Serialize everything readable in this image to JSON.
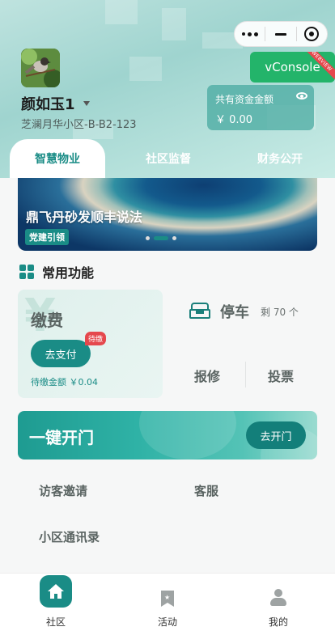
{
  "capsule": {
    "more_icon": "more-dots-icon",
    "minimize_icon": "minimize-icon",
    "close_icon": "target-close-icon"
  },
  "user": {
    "name": "颜如玉1",
    "address": "芝澜月华小区-B-B2-123"
  },
  "vconsole": {
    "label": "vConsole",
    "ribbon": "WEBVIEW"
  },
  "fund": {
    "label": "共有资金金额",
    "amount": "￥ 0.00"
  },
  "tabs": [
    {
      "label": "智慧物业",
      "active": true
    },
    {
      "label": "社区监督"
    },
    {
      "label": "财务公开"
    }
  ],
  "banner": {
    "title": "鼎飞丹砂发顺丰说法",
    "tag": "党建引领"
  },
  "functions": {
    "title": "常用功能",
    "pay": {
      "title": "缴费",
      "button": "去支付",
      "badge": "待缴",
      "amount": "待缴金额 ￥0.04"
    },
    "parking": {
      "label": "停车",
      "remain": "剩 70 个"
    },
    "repair": "报修",
    "vote": "投票"
  },
  "door": {
    "title": "一键开门",
    "button": "去开门"
  },
  "links": {
    "visitor": "访客邀请",
    "service": "客服",
    "directory": "小区通讯录"
  },
  "tabbar": [
    {
      "label": "社区",
      "active": true
    },
    {
      "label": "活动"
    },
    {
      "label": "我的"
    }
  ],
  "colors": {
    "accent": "#1a8c86",
    "green": "#23b46a",
    "badge": "#e5484d"
  }
}
